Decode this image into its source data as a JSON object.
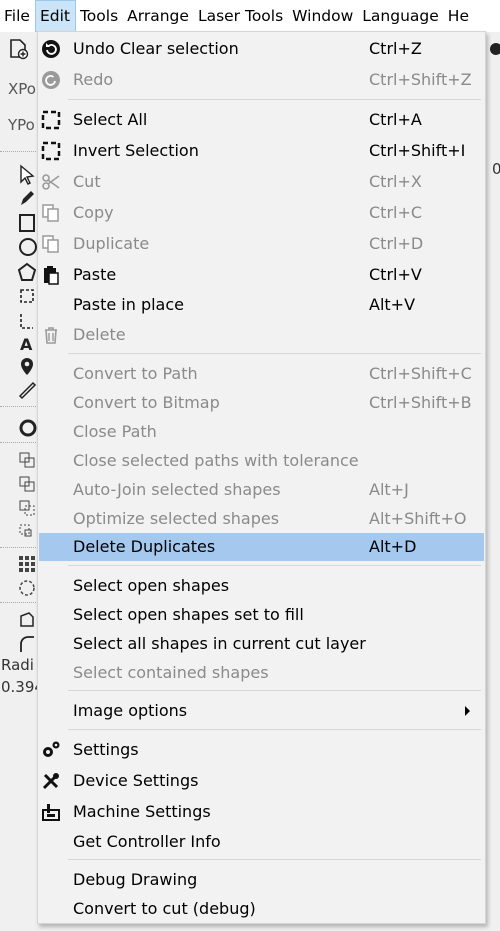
{
  "menubar": {
    "items": [
      "File",
      "Edit",
      "Tools",
      "Arrange",
      "Laser Tools",
      "Window",
      "Language",
      "He"
    ]
  },
  "background": {
    "xpos_label": "XPo",
    "ypos_label": "YPo",
    "radius_label": "Radi",
    "radius_value": "0.394",
    "right_digit": "0"
  },
  "edit_menu": {
    "undo": {
      "label": "Undo Clear selection",
      "shortcut": "Ctrl+Z"
    },
    "redo": {
      "label": "Redo",
      "shortcut": "Ctrl+Shift+Z"
    },
    "select_all": {
      "label": "Select All",
      "shortcut": "Ctrl+A"
    },
    "invert_selection": {
      "label": "Invert Selection",
      "shortcut": "Ctrl+Shift+I"
    },
    "cut": {
      "label": "Cut",
      "shortcut": "Ctrl+X"
    },
    "copy": {
      "label": "Copy",
      "shortcut": "Ctrl+C"
    },
    "duplicate": {
      "label": "Duplicate",
      "shortcut": "Ctrl+D"
    },
    "paste": {
      "label": "Paste",
      "shortcut": "Ctrl+V"
    },
    "paste_in_place": {
      "label": "Paste in place",
      "shortcut": "Alt+V"
    },
    "delete": {
      "label": "Delete",
      "shortcut": ""
    },
    "convert_to_path": {
      "label": "Convert to Path",
      "shortcut": "Ctrl+Shift+C"
    },
    "convert_to_bitmap": {
      "label": "Convert to Bitmap",
      "shortcut": "Ctrl+Shift+B"
    },
    "close_path": {
      "label": "Close Path",
      "shortcut": ""
    },
    "close_selected_paths": {
      "label": "Close selected paths with tolerance",
      "shortcut": ""
    },
    "auto_join": {
      "label": "Auto-Join selected shapes",
      "shortcut": "Alt+J"
    },
    "optimize": {
      "label": "Optimize selected shapes",
      "shortcut": "Alt+Shift+O"
    },
    "delete_duplicates": {
      "label": "Delete Duplicates",
      "shortcut": "Alt+D"
    },
    "select_open_shapes": {
      "label": "Select open shapes",
      "shortcut": ""
    },
    "select_open_shapes_fill": {
      "label": "Select open shapes set to fill",
      "shortcut": ""
    },
    "select_all_cut_layer": {
      "label": "Select all shapes in current cut layer",
      "shortcut": ""
    },
    "select_contained": {
      "label": "Select contained shapes",
      "shortcut": ""
    },
    "image_options": {
      "label": "Image options",
      "shortcut": ""
    },
    "settings": {
      "label": "Settings",
      "shortcut": ""
    },
    "device_settings": {
      "label": "Device Settings",
      "shortcut": ""
    },
    "machine_settings": {
      "label": "Machine Settings",
      "shortcut": ""
    },
    "get_controller_info": {
      "label": "Get Controller Info",
      "shortcut": ""
    },
    "debug_drawing": {
      "label": "Debug Drawing",
      "shortcut": ""
    },
    "convert_to_cut_debug": {
      "label": "Convert to cut (debug)",
      "shortcut": ""
    }
  },
  "colors": {
    "highlight": "#a5c8ef",
    "disabled_text": "#8a8a8a",
    "menu_bg": "#f2f2f2"
  }
}
